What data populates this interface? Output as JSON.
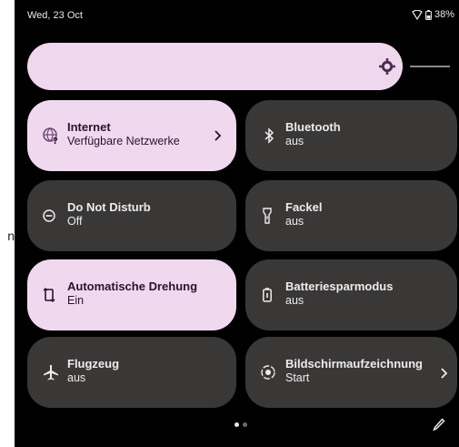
{
  "side_text": "n",
  "status": {
    "date": "Wed, 23 Oct",
    "battery": "38%"
  },
  "brightness": {
    "level": 0.92
  },
  "tiles": [
    {
      "title": "Internet",
      "subtitle": "Verfügbare Netzwerke",
      "icon": "wifi-question-icon",
      "active": true,
      "chevron": true
    },
    {
      "title": "Bluetooth",
      "subtitle": "aus",
      "icon": "bluetooth-icon",
      "active": false,
      "chevron": false
    },
    {
      "title": "Do Not Disturb",
      "subtitle": "Off",
      "icon": "do-not-disturb-icon",
      "active": false,
      "chevron": false
    },
    {
      "title": "Fackel",
      "subtitle": "aus",
      "icon": "flashlight-icon",
      "active": false,
      "chevron": false
    },
    {
      "title": "Automatische Drehung",
      "subtitle": "Ein",
      "icon": "rotate-icon",
      "active": true,
      "chevron": false
    },
    {
      "title": "Batteriesparmodus",
      "subtitle": "aus",
      "icon": "battery-saver-icon",
      "active": false,
      "chevron": false
    },
    {
      "title": "Flugzeug",
      "subtitle": "aus",
      "icon": "airplane-icon",
      "active": false,
      "chevron": false
    },
    {
      "title": "Bildschirmaufzeichnung",
      "subtitle": "Start",
      "icon": "screen-record-icon",
      "active": false,
      "chevron": true
    }
  ],
  "pager": {
    "pages": 2,
    "current": 1
  },
  "colors": {
    "active_tile": "#f0d9ef",
    "inactive_tile": "#3a3737",
    "background": "#000000"
  }
}
